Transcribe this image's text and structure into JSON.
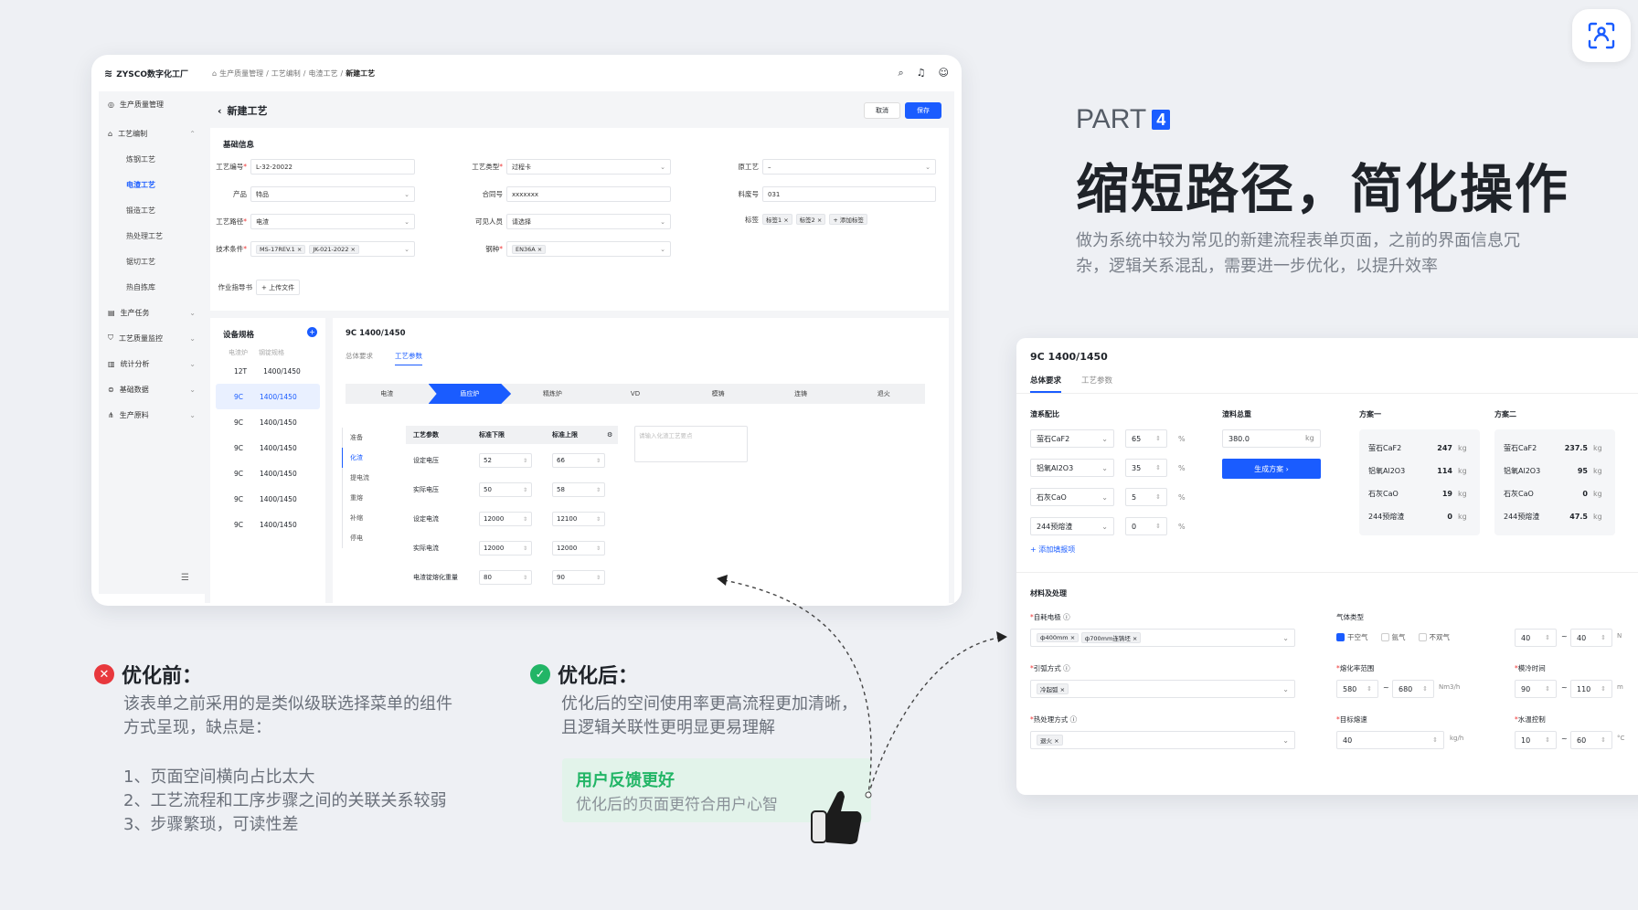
{
  "top_button": {
    "icon": "scan-icon"
  },
  "appA": {
    "logo": "ZYSCO数字化工厂",
    "breadcrumb": [
      "生产质量管理",
      "工艺编制",
      "电渣工艺"
    ],
    "breadcrumb_current": "新建工艺",
    "sidebar": {
      "items": [
        {
          "label": "生产质量管理",
          "icon": "gauge-icon"
        },
        {
          "label": "工艺编制",
          "icon": "home-icon"
        }
      ],
      "sub_items": [
        "炼钢工艺",
        "电渣工艺",
        "锻造工艺",
        "热处理工艺",
        "锯切工艺",
        "热自拣库"
      ],
      "lower_items": [
        {
          "label": "生产任务",
          "icon": "task-icon"
        },
        {
          "label": "工艺质量监控",
          "icon": "shield-icon"
        },
        {
          "label": "统计分析",
          "icon": "chart-icon"
        },
        {
          "label": "基础数据",
          "icon": "database-icon"
        },
        {
          "label": "生产原料",
          "icon": "material-icon"
        }
      ]
    },
    "page_title": "新建工艺",
    "cancel": "取消",
    "save": "保存",
    "basic": {
      "title": "基础信息",
      "process_no_label": "工艺编号",
      "process_no": "L-32-20022",
      "process_type_label": "工艺类型",
      "process_type": "过程卡",
      "original_label": "原工艺",
      "original": "–",
      "product_label": "产品",
      "product": "特品",
      "contract_label": "合同号",
      "contract": "xxxxxxx",
      "stock_label": "料废号",
      "stock": "031",
      "route_label": "工艺路径",
      "route": "电渣",
      "visible_label": "可见人员",
      "visible": "请选择",
      "tag_label": "标签",
      "tags": [
        "标签1",
        "标签2"
      ],
      "add_tag": "+ 添加标签",
      "tech_label": "技术条件",
      "tech": [
        "MS-17REV.1",
        "JK-021-2022"
      ],
      "steel_label": "钢种",
      "steel": [
        "EN36A"
      ],
      "guide_label": "作业指导书",
      "upload": "+ 上传文件"
    },
    "equip": {
      "title": "设备规格",
      "head": [
        "电渣炉",
        "钢锭规格"
      ],
      "rows": [
        [
          "12T",
          "1400/1450"
        ],
        [
          "9C",
          "1400/1450"
        ],
        [
          "9C",
          "1400/1450"
        ],
        [
          "9C",
          "1400/1450"
        ],
        [
          "9C",
          "1400/1450"
        ],
        [
          "9C",
          "1400/1450"
        ],
        [
          "9C",
          "1400/1450"
        ]
      ]
    },
    "detail": {
      "title": "9C  1400/1450",
      "tabs": [
        "总体要求",
        "工艺参数"
      ],
      "steps": [
        "电渣",
        "盾应炉",
        "精炼炉",
        "VD",
        "模铸",
        "连铸",
        "退火"
      ],
      "vnav": [
        "准备",
        "化渣",
        "提电流",
        "重熔",
        "补缩",
        "停电"
      ],
      "table_head": [
        "工艺参数",
        "标准下限",
        "标准上限"
      ],
      "rows": [
        [
          "设定电压",
          "52",
          "66"
        ],
        [
          "实际电压",
          "50",
          "58"
        ],
        [
          "设定电流",
          "12000",
          "12100"
        ],
        [
          "实际电流",
          "12000",
          "12000"
        ],
        [
          "电渣锭熔化重量",
          "80",
          "90"
        ]
      ],
      "note_placeholder": "请输入化渣工艺要点"
    }
  },
  "right_text": {
    "part": "PART",
    "part_num": "4",
    "headline": "缩短路径，简化操作",
    "desc": "做为系统中较为常见的新建流程表单页面，之前的界面信息冗杂，逻辑关系混乱，需要进一步优化，以提升效率"
  },
  "appB": {
    "title": "9C  1400/1450",
    "tabs": [
      "总体要求",
      "工艺参数"
    ],
    "slag": {
      "title": "渣系配比",
      "rows": [
        [
          "萤石CaF2",
          "65"
        ],
        [
          "铝氧Al2O3",
          "35"
        ],
        [
          "石灰CaO",
          "5"
        ],
        [
          "244预熔渣",
          "0"
        ]
      ],
      "unit": "%",
      "add": "添加填报项"
    },
    "total": {
      "title": "渣料总重",
      "value": "380.0",
      "unit": "kg",
      "btn": "生成方案 ›"
    },
    "plan1": {
      "title": "方案一",
      "rows": [
        [
          "萤石CaF2",
          "247"
        ],
        [
          "铝氧Al2O3",
          "114"
        ],
        [
          "石灰CaO",
          "19"
        ],
        [
          "244预熔渣",
          "0"
        ]
      ]
    },
    "plan2": {
      "title": "方案二",
      "rows": [
        [
          "萤石CaF2",
          "237.5"
        ],
        [
          "铝氧Al2O3",
          "95"
        ],
        [
          "石灰CaO",
          "0"
        ],
        [
          "244预熔渣",
          "47.5"
        ]
      ]
    },
    "kg": "kg",
    "material": {
      "title": "材料及处理",
      "electrode_label": "自耗电极",
      "electrode_tags": [
        "ф400mm",
        "ф700mm连铸坯"
      ],
      "arc_label": "引弧方式",
      "arc_tags": [
        "冷起弧"
      ],
      "hot_label": "热处理方式",
      "hot_tags": [
        "退火"
      ],
      "gas_label": "气体类型",
      "gas": [
        "干空气",
        "氩气",
        "不双气"
      ],
      "gas_min": "40",
      "gas_max": "40",
      "gas_unit": "N",
      "flow_label": "熔化率范围",
      "flow_min": "580",
      "flow_max": "680",
      "flow_unit": "Nm3/h",
      "cool_label": "模冷时间",
      "cool_min": "90",
      "cool_max": "110",
      "cool_unit": "m",
      "target_label": "目标熔速",
      "target": "40",
      "target_unit": "kg/h",
      "water_label": "水温控制",
      "water_min": "10",
      "water_max": "60",
      "water_unit": "°C",
      "tilde": "~"
    }
  },
  "before": {
    "title": "优化前：",
    "text1": "该表单之前采用的是类似级联选择菜单的组件",
    "text2": "方式呈现，缺点是：",
    "points": [
      "1、页面空间横向占比太大",
      "2、工艺流程和工序步骤之间的关联关系较弱",
      "3、步骤繁琐，可读性差"
    ],
    "color": "#e8383d"
  },
  "after": {
    "title": "优化后：",
    "text1": "优化后的空间使用率更高流程更加清晰，",
    "text2": "且逻辑关联性更明显更易理解",
    "color": "#22b566"
  },
  "feedback": {
    "title": "用户反馈更好",
    "sub": "优化后的页面更符合用户心智"
  }
}
